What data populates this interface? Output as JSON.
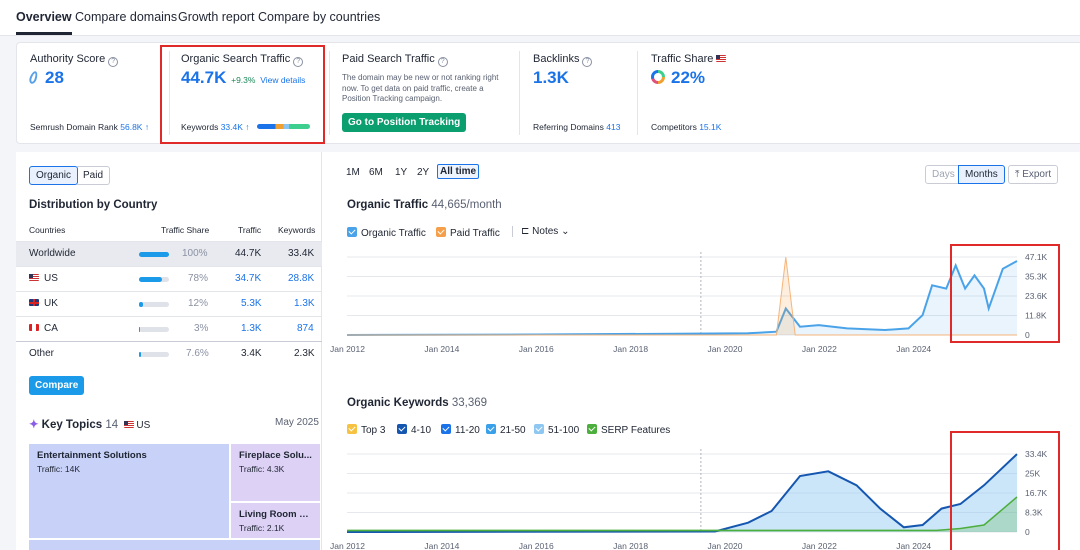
{
  "tabs": [
    "Overview",
    "Compare domains",
    "Growth report",
    "Compare by countries"
  ],
  "kpi": {
    "authority": {
      "label": "Authority Score",
      "value": "28",
      "sub_label": "Semrush Domain Rank",
      "sub_value": "56.8K ↑"
    },
    "organic": {
      "label": "Organic Search Traffic",
      "value": "44.7K",
      "change": "+9.3%",
      "link": "View details",
      "sub_label": "Keywords",
      "sub_value": "33.4K ↑"
    },
    "paid": {
      "label": "Paid Search Traffic",
      "note": "The domain may be new or not ranking right now. To get data on paid traffic, create a Position Tracking campaign.",
      "button": "Go to Position Tracking"
    },
    "backlinks": {
      "label": "Backlinks",
      "value": "1.3K",
      "sub_label": "Referring Domains",
      "sub_value": "413"
    },
    "share": {
      "label": "Traffic Share",
      "value": "22%",
      "sub_label": "Competitors",
      "sub_value": "15.1K"
    }
  },
  "left": {
    "toggle": [
      "Organic",
      "Paid"
    ],
    "title": "Distribution by Country",
    "headers": [
      "Countries",
      "Traffic Share",
      "Traffic",
      "Keywords"
    ],
    "rows": [
      {
        "country": "Worldwide",
        "share": "100%",
        "share_value": 1.0,
        "traffic": "44.7K",
        "keywords": "33.4K"
      },
      {
        "country": "US",
        "share": "78%",
        "share_value": 0.78,
        "traffic": "34.7K",
        "keywords": "28.8K"
      },
      {
        "country": "UK",
        "share": "12%",
        "share_value": 0.12,
        "traffic": "5.3K",
        "keywords": "1.3K"
      },
      {
        "country": "CA",
        "share": "3%",
        "share_value": 0.03,
        "traffic": "1.3K",
        "keywords": "874"
      },
      {
        "country": "Other",
        "share": "7.6%",
        "share_value": 0.076,
        "traffic": "3.4K",
        "keywords": "2.3K"
      }
    ],
    "compare_button": "Compare",
    "key_topics": {
      "title": "Key Topics",
      "count": "14",
      "country": "US",
      "date": "May 2025"
    },
    "tiles": [
      {
        "name": "Entertainment Solutions",
        "traffic": "Traffic: 14K"
      },
      {
        "name": "Fireplace Solu...",
        "traffic": "Traffic: 4.3K"
      },
      {
        "name": "Living Room S...",
        "traffic": "Traffic: 2.1K"
      }
    ]
  },
  "right": {
    "ranges": [
      "1M",
      "6M",
      "1Y",
      "2Y",
      "All time"
    ],
    "granularity": [
      "Days",
      "Months"
    ],
    "export": "Export",
    "traffic_title": "Organic Traffic",
    "traffic_value": "44,665/month",
    "traffic_legend": [
      "Organic Traffic",
      "Paid Traffic",
      "Notes"
    ],
    "keywords_title": "Organic Keywords",
    "keywords_value": "33,369",
    "keywords_legend": [
      "Top 3",
      "4-10",
      "11-20",
      "21-50",
      "51-100",
      "SERP Features"
    ]
  },
  "colors": {
    "accent": "#1a73e8",
    "green": "#0b9e6f",
    "highlight": "#e02a2a",
    "organic": "#4aa3e8",
    "paid": "#f59f4a"
  },
  "chart_data": [
    {
      "type": "line",
      "title": "Organic Traffic",
      "x_ticks": [
        "Jan 2012",
        "Jan 2014",
        "Jan 2016",
        "Jan 2018",
        "Jan 2020",
        "Jan 2022",
        "Jan 2024"
      ],
      "y_ticks": [
        "47.1K",
        "35.3K",
        "23.6K",
        "11.8K",
        "0"
      ],
      "ylim": [
        0,
        47100
      ],
      "series": [
        {
          "name": "Organic Traffic",
          "x": [
            2012,
            2016,
            2019,
            2020.5,
            2021.1,
            2021.3,
            2021.6,
            2022,
            2022.6,
            2023.4,
            2023.9,
            2024.2,
            2024.4,
            2024.7,
            2024.9,
            2025.1,
            2025.3,
            2025.5,
            2025.6,
            2025.9,
            2026.2
          ],
          "y": [
            0,
            300,
            800,
            1000,
            2000,
            16000,
            5000,
            6000,
            4000,
            3000,
            4000,
            12000,
            30000,
            28000,
            42000,
            28000,
            36000,
            28000,
            16000,
            40000,
            44665
          ]
        },
        {
          "name": "Paid Traffic",
          "x": [
            2012,
            2021.1,
            2021.3,
            2021.5,
            2026.2
          ],
          "y": [
            0,
            0,
            47000,
            0,
            0
          ]
        }
      ]
    },
    {
      "type": "area",
      "title": "Organic Keywords",
      "x_ticks": [
        "Jan 2012",
        "Jan 2014",
        "Jan 2016",
        "Jan 2018",
        "Jan 2020",
        "Jan 2022",
        "Jan 2024"
      ],
      "y_ticks": [
        "33.4K",
        "25K",
        "16.7K",
        "8.3K",
        "0"
      ],
      "ylim": [
        0,
        33400
      ],
      "series": [
        {
          "name": "Total",
          "x": [
            2012,
            2019.8,
            2020.5,
            2021,
            2021.6,
            2022.2,
            2022.8,
            2023.3,
            2023.8,
            2024.2,
            2024.6,
            2025,
            2025.5,
            2026.2
          ],
          "y": [
            0,
            200,
            4000,
            9000,
            24000,
            26000,
            20000,
            10000,
            2000,
            3000,
            10000,
            12000,
            20000,
            33369
          ]
        },
        {
          "name": "SERP Features",
          "x": [
            2012,
            2024.5,
            2025,
            2025.5,
            2026.2
          ],
          "y": [
            700,
            700,
            1500,
            3000,
            15000
          ]
        }
      ]
    }
  ]
}
